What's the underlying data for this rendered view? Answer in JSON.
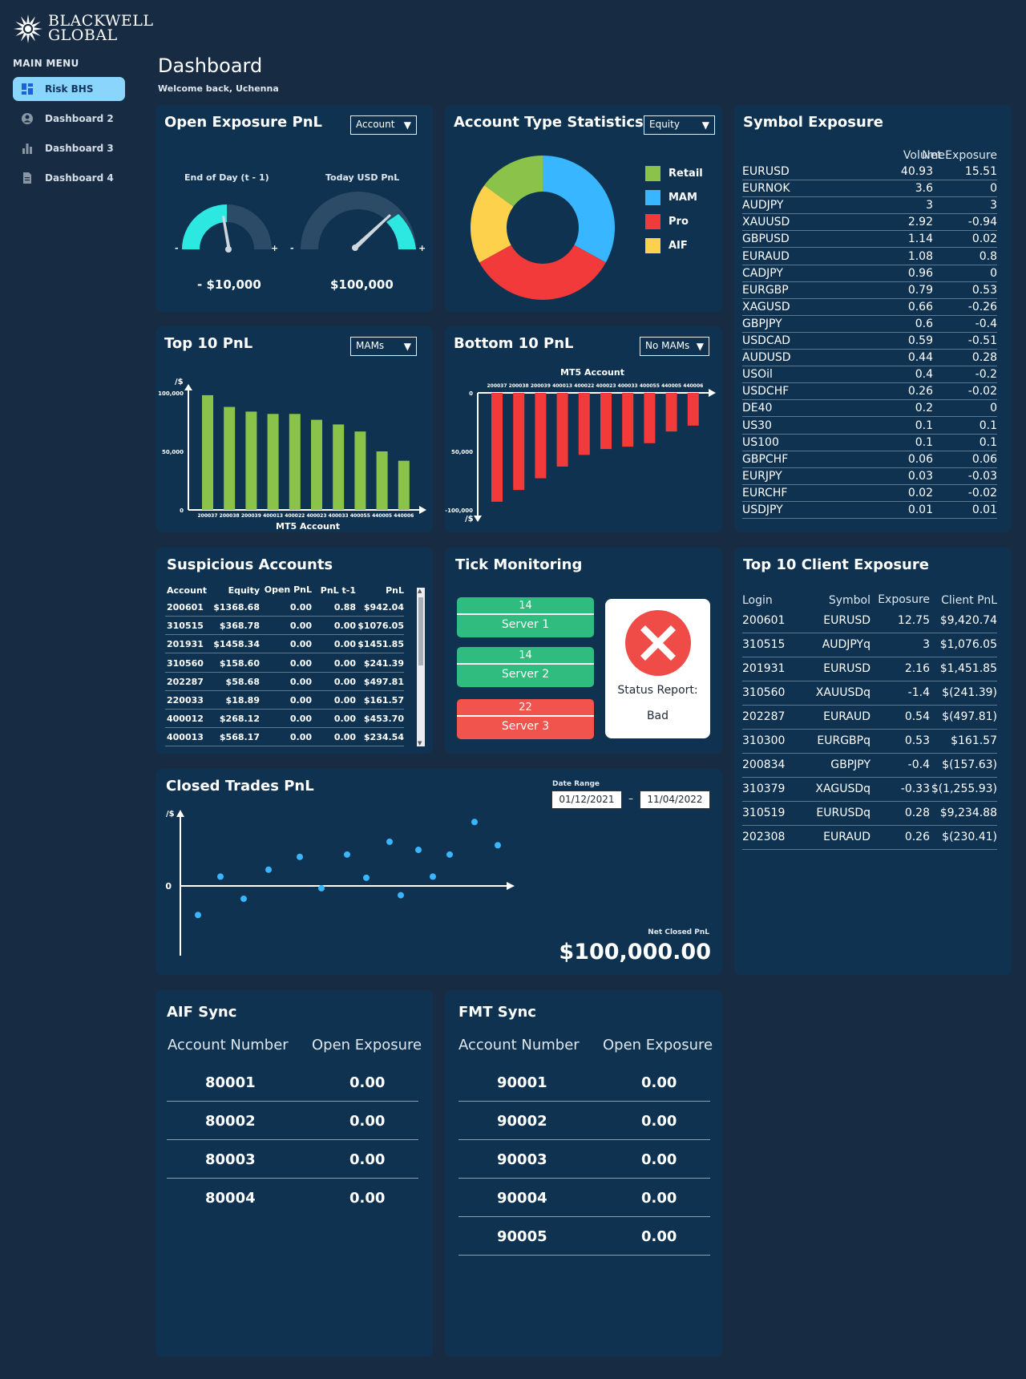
{
  "brand": {
    "name_line1": "BLACKWELL",
    "name_line2": "GLOBAL"
  },
  "sidebar": {
    "title": "MAIN MENU",
    "items": [
      {
        "label": "Risk BHS",
        "icon": "dashboard-grid-icon"
      },
      {
        "label": "Dashboard 2",
        "icon": "user-circle-icon"
      },
      {
        "label": "Dashboard 3",
        "icon": "bar-chart-icon"
      },
      {
        "label": "Dashboard 4",
        "icon": "document-icon"
      }
    ]
  },
  "header": {
    "title": "Dashboard",
    "welcome": "Welcome back, Uchenna"
  },
  "colors": {
    "page_bg": "#172c43",
    "card_bg": "#0e3250",
    "accent": "#8ad5fb",
    "teal": "#2ce8e0",
    "green": "#8bc34a",
    "red": "#f23a3a",
    "blue": "#38b6ff",
    "yellow": "#fdd14b"
  },
  "open_exposure": {
    "title": "Open Exposure PnL",
    "dropdown": "Account",
    "gauges": [
      {
        "label": "End of Day (t - 1)",
        "value_text": "- $10,000",
        "min": "-",
        "max": "+"
      },
      {
        "label": "Today USD PnL",
        "value_text": "$100,000",
        "min": "-",
        "max": "+"
      }
    ]
  },
  "account_type": {
    "title": "Account Type Statistics",
    "dropdown": "Equity",
    "legend": [
      {
        "label": "Retail",
        "color": "#8bc34a"
      },
      {
        "label": "MAM",
        "color": "#38b6ff"
      },
      {
        "label": "Pro",
        "color": "#f23a3a"
      },
      {
        "label": "AIF",
        "color": "#fdd14b"
      }
    ]
  },
  "symbol_exposure": {
    "title": "Symbol Exposure",
    "headers": [
      "Volume",
      "Net Exposure"
    ],
    "rows": [
      [
        "EURUSD",
        "40.93",
        "15.51"
      ],
      [
        "EURNOK",
        "3.6",
        "0"
      ],
      [
        "AUDJPY",
        "3",
        "3"
      ],
      [
        "XAUUSD",
        "2.92",
        "-0.94"
      ],
      [
        "GBPUSD",
        "1.14",
        "0.02"
      ],
      [
        "EURAUD",
        "1.08",
        "0.8"
      ],
      [
        "CADJPY",
        "0.96",
        "0"
      ],
      [
        "EURGBP",
        "0.79",
        "0.53"
      ],
      [
        "XAGUSD",
        "0.66",
        "-0.26"
      ],
      [
        "GBPJPY",
        "0.6",
        "-0.4"
      ],
      [
        "USDCAD",
        "0.59",
        "-0.51"
      ],
      [
        "AUDUSD",
        "0.44",
        "0.28"
      ],
      [
        "USOil",
        "0.4",
        "-0.2"
      ],
      [
        "USDCHF",
        "0.26",
        "-0.02"
      ],
      [
        "DE40",
        "0.2",
        "0"
      ],
      [
        "US30",
        "0.1",
        "0.1"
      ],
      [
        "US100",
        "0.1",
        "0.1"
      ],
      [
        "GBPCHF",
        "0.06",
        "0.06"
      ],
      [
        "EURJPY",
        "0.03",
        "-0.03"
      ],
      [
        "EURCHF",
        "0.02",
        "-0.02"
      ],
      [
        "USDJPY",
        "0.01",
        "0.01"
      ]
    ]
  },
  "top10": {
    "title": "Top 10 PnL",
    "dropdown": "MAMs",
    "ylabel": "/$",
    "xlabel": "MT5 Account",
    "yticks": [
      "100,000",
      "50,000",
      "0"
    ]
  },
  "bottom10": {
    "title": "Bottom 10 PnL",
    "dropdown": "No MAMs",
    "ylabel": "/$",
    "xlabel": "MT5 Account",
    "yticks": [
      "0",
      "50,000",
      "-100,000"
    ]
  },
  "chart_data": [
    {
      "type": "bar",
      "title": "Top 10 PnL",
      "xlabel": "MT5 Account",
      "ylabel": "/$",
      "categories": [
        "200037",
        "200038",
        "200039",
        "400013",
        "400022",
        "400023",
        "400033",
        "400055",
        "440005",
        "440006"
      ],
      "values": [
        98000,
        88000,
        84000,
        82000,
        82000,
        77000,
        73000,
        67000,
        50000,
        42000
      ],
      "ylim": [
        0,
        100000
      ]
    },
    {
      "type": "bar",
      "title": "Bottom 10 PnL",
      "xlabel": "MT5 Account",
      "ylabel": "/$",
      "categories": [
        "200037",
        "200038",
        "200039",
        "400013",
        "400022",
        "400023",
        "400033",
        "400055",
        "440005",
        "440006"
      ],
      "values": [
        -93000,
        -83000,
        -73000,
        -63000,
        -53000,
        -48000,
        -46000,
        -43000,
        -33000,
        -28000
      ],
      "ylim": [
        -100000,
        0
      ]
    },
    {
      "type": "pie",
      "title": "Account Type Statistics",
      "categories": [
        "MAM",
        "Pro",
        "AIF",
        "Retail"
      ],
      "values": [
        33,
        34,
        18,
        15
      ]
    },
    {
      "type": "scatter",
      "title": "Closed Trades PnL",
      "ylabel": "/$",
      "x": [
        1,
        2,
        3,
        4,
        5,
        6,
        7,
        8,
        9,
        10,
        11,
        12,
        13,
        14,
        15,
        16,
        17
      ],
      "y": [
        -25,
        8,
        -11,
        14,
        25,
        -2,
        27,
        7,
        38,
        -8,
        31,
        8,
        27,
        55,
        35
      ],
      "note": "",
      "points": []
    }
  ],
  "suspicious": {
    "title": "Suspicious Accounts",
    "headers": [
      "Account",
      "Equity",
      "Open PnL",
      "PnL t-1",
      "PnL"
    ],
    "rows": [
      [
        "200601",
        "$1368.68",
        "0.00",
        "0.88",
        "$942.04"
      ],
      [
        "310515",
        "$368.78",
        "0.00",
        "0.00",
        "$1076.05"
      ],
      [
        "201931",
        "$1458.34",
        "0.00",
        "0.00",
        "$1451.85"
      ],
      [
        "310560",
        "$158.60",
        "0.00",
        "0.00",
        "$241.39"
      ],
      [
        "202287",
        "$58.68",
        "0.00",
        "0.00",
        "$497.81"
      ],
      [
        "220033",
        "$18.89",
        "0.00",
        "0.00",
        "$161.57"
      ],
      [
        "400012",
        "$268.12",
        "0.00",
        "0.00",
        "$453.70"
      ],
      [
        "400013",
        "$568.17",
        "0.00",
        "0.00",
        "$234.54"
      ]
    ]
  },
  "tick": {
    "title": "Tick Monitoring",
    "servers": [
      {
        "count": "14",
        "name": "Server 1",
        "status": "ok"
      },
      {
        "count": "14",
        "name": "Server 2",
        "status": "ok"
      },
      {
        "count": "22",
        "name": "Server 3",
        "status": "bad"
      }
    ],
    "status_label": "Status Report:",
    "status_value": "Bad"
  },
  "client_exposure": {
    "title": "Top 10 Client Exposure",
    "headers": [
      "Login",
      "Symbol",
      "Exposure",
      "Client PnL"
    ],
    "rows": [
      [
        "200601",
        "EURUSD",
        "12.75",
        "$9,420.74"
      ],
      [
        "310515",
        "AUDJPYq",
        "3",
        "$1,076.05"
      ],
      [
        "201931",
        "EURUSD",
        "2.16",
        "$1,451.85"
      ],
      [
        "310560",
        "XAUUSDq",
        "-1.4",
        "$(241.39)"
      ],
      [
        "202287",
        "EURAUD",
        "0.54",
        "$(497.81)"
      ],
      [
        "310300",
        "EURGBPq",
        "0.53",
        "$161.57"
      ],
      [
        "200834",
        "GBPJPY",
        "-0.4",
        "$(157.63)"
      ],
      [
        "310379",
        "XAGUSDq",
        "-0.33",
        "$(1,255.93)"
      ],
      [
        "310519",
        "EURUSDq",
        "0.28",
        "$9,234.88"
      ],
      [
        "202308",
        "EURAUD",
        "0.26",
        "$(230.41)"
      ]
    ]
  },
  "closed_trades": {
    "title": "Closed Trades PnL",
    "date_range_label": "Date Range",
    "date_from": "01/12/2021",
    "date_to": "11/04/2022",
    "date_sep": "–",
    "ylabel": "/$",
    "zero": "0",
    "net_label": "Net Closed PnL",
    "net_value": "$100,000.00"
  },
  "aif_sync": {
    "title": "AIF Sync",
    "headers": [
      "Account Number",
      "Open Exposure"
    ],
    "rows": [
      [
        "80001",
        "0.00"
      ],
      [
        "80002",
        "0.00"
      ],
      [
        "80003",
        "0.00"
      ],
      [
        "80004",
        "0.00"
      ]
    ]
  },
  "fmt_sync": {
    "title": "FMT Sync",
    "headers": [
      "Account Number",
      "Open Exposure"
    ],
    "rows": [
      [
        "90001",
        "0.00"
      ],
      [
        "90002",
        "0.00"
      ],
      [
        "90003",
        "0.00"
      ],
      [
        "90004",
        "0.00"
      ],
      [
        "90005",
        "0.00"
      ]
    ]
  }
}
